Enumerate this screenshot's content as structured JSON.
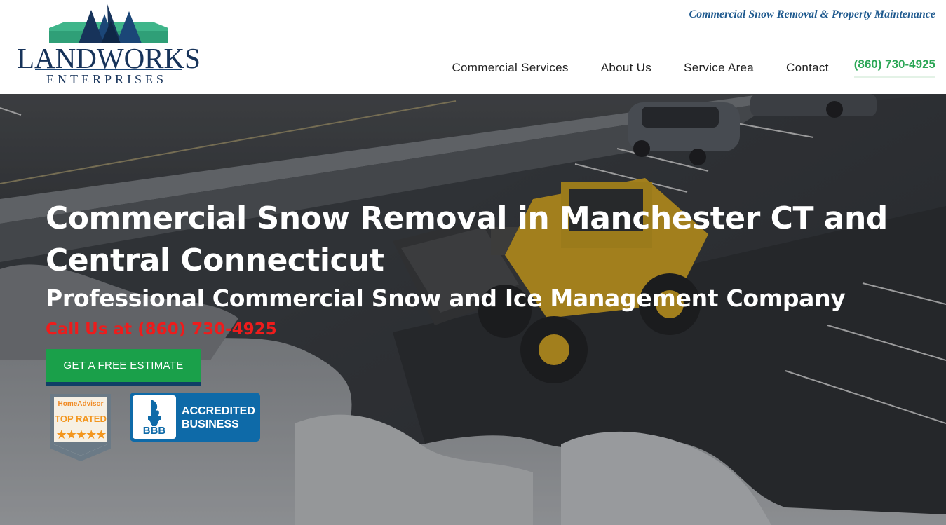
{
  "header": {
    "logo_word": "LANDWORKS",
    "logo_sub": "ENTERPRISES",
    "tagline": "Commercial Snow Removal & Property Maintenance",
    "nav": [
      {
        "label": "Commercial Services"
      },
      {
        "label": "About Us"
      },
      {
        "label": "Service Area"
      },
      {
        "label": "Contact"
      }
    ],
    "phone": "(860) 730-4925"
  },
  "hero": {
    "title": "Commercial Snow Removal in Manchester CT and Central Connecticut",
    "subtitle": "Professional Commercial Snow and Ice Management Company",
    "call": "Call Us at (860) 730-4925",
    "cta_label": "GET A FREE ESTIMATE"
  },
  "badges": {
    "homeadvisor": {
      "brand": "HomeAdvisor",
      "rating": "TOP RATED",
      "stars": "★★★★★"
    },
    "bbb": {
      "seal": "BBB",
      "line1": "ACCREDITED",
      "line2": "BUSINESS"
    }
  },
  "colors": {
    "brand_navy": "#17335a",
    "accent_green": "#1aa04a",
    "phone_green": "#2aa655",
    "call_red": "#ee1c1c",
    "bbb_blue": "#0e6aa8"
  }
}
